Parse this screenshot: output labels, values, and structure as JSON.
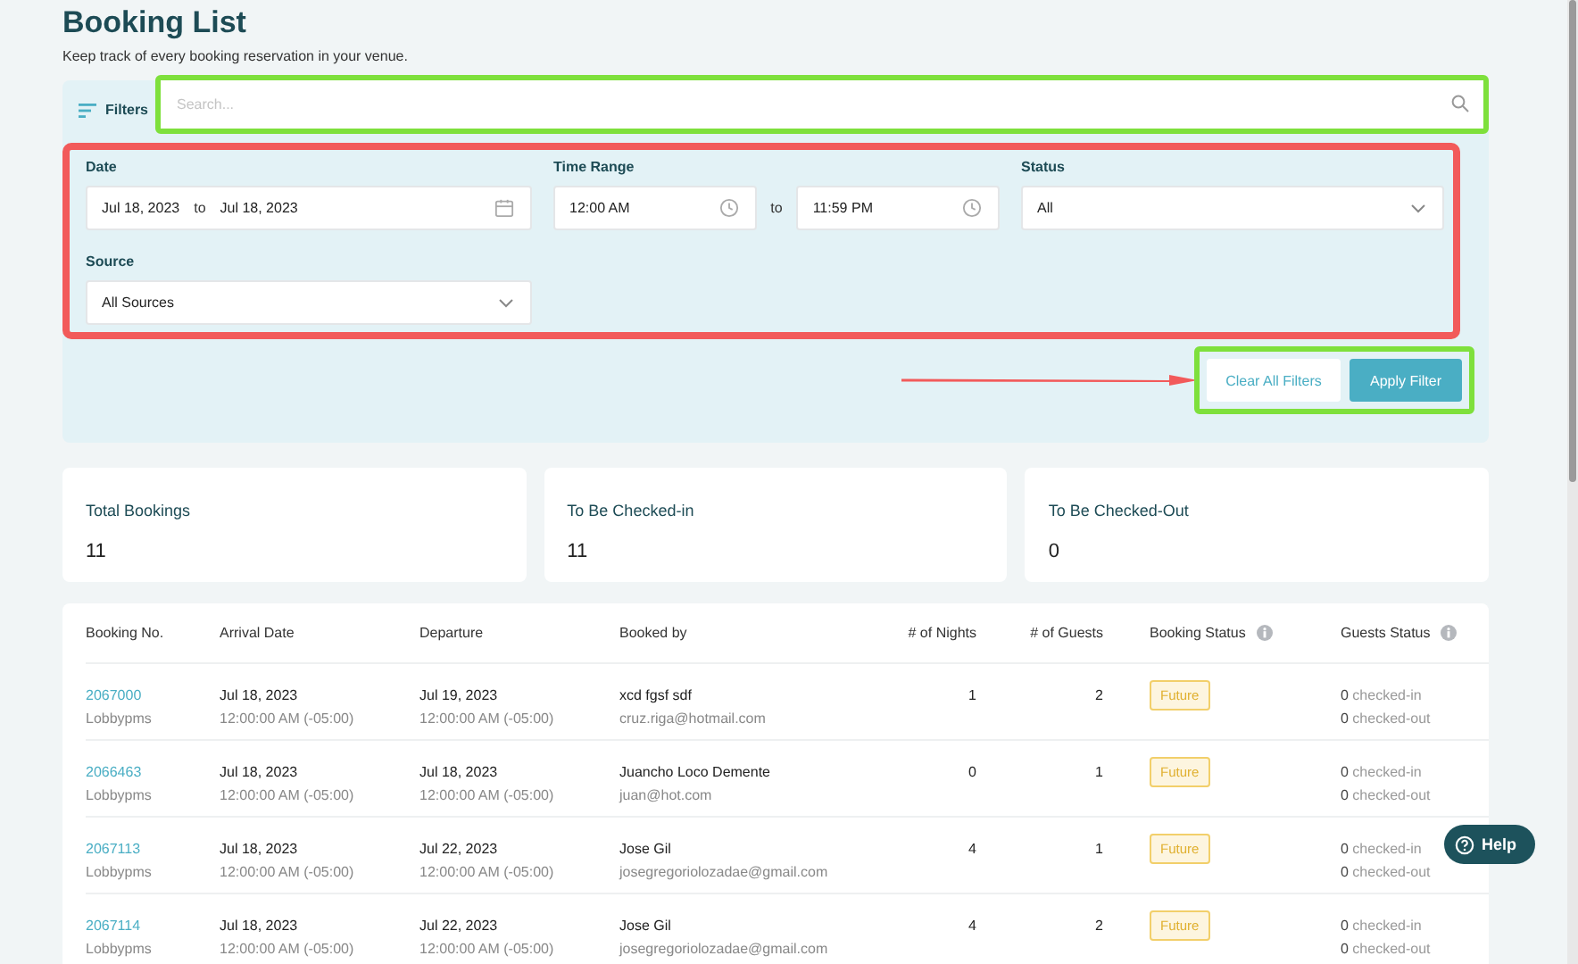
{
  "header": {
    "title": "Booking List",
    "subtitle": "Keep track of every booking reservation in your venue."
  },
  "filters": {
    "label": "Filters",
    "search": {
      "placeholder": "Search..."
    },
    "date": {
      "label": "Date",
      "from": "Jul 18, 2023",
      "separator": "to",
      "to": "Jul 18, 2023"
    },
    "time_range": {
      "label": "Time Range",
      "from": "12:00 AM",
      "separator": "to",
      "to": "11:59 PM"
    },
    "status": {
      "label": "Status",
      "value": "All"
    },
    "source": {
      "label": "Source",
      "value": "All Sources"
    },
    "buttons": [
      {
        "label": "Clear All Filters",
        "kind": "secondary"
      },
      {
        "label": "Apply Filter",
        "kind": "primary"
      }
    ]
  },
  "stats": [
    {
      "label": "Total Bookings",
      "value": "11"
    },
    {
      "label": "To Be Checked-in",
      "value": "11"
    },
    {
      "label": "To Be Checked-Out",
      "value": "0"
    }
  ],
  "table": {
    "columns": [
      {
        "label": "Booking No.",
        "info": false
      },
      {
        "label": "Arrival Date",
        "info": false
      },
      {
        "label": "Departure",
        "info": false
      },
      {
        "label": "Booked by",
        "info": false
      },
      {
        "label": "# of Nights",
        "info": false
      },
      {
        "label": "# of Guests",
        "info": false
      },
      {
        "label": "Booking Status",
        "info": true
      },
      {
        "label": "Guests Status",
        "info": true
      }
    ],
    "rows": [
      {
        "booking_no": "2067000",
        "source": "Lobbypms",
        "arrival_date": "Jul 18, 2023",
        "arrival_time": "12:00:00 AM (-05:00)",
        "departure_date": "Jul 19, 2023",
        "departure_time": "12:00:00 AM (-05:00)",
        "name": "xcd fgsf sdf",
        "email": "cruz.riga@hotmail.com",
        "nights": "1",
        "guests": "2",
        "status": "Future",
        "checked_in": "**0** checked-in",
        "checked_out": "**0** checked-out"
      },
      {
        "booking_no": "2066463",
        "source": "Lobbypms",
        "arrival_date": "Jul 18, 2023",
        "arrival_time": "12:00:00 AM (-05:00)",
        "departure_date": "Jul 18, 2023",
        "departure_time": "12:00:00 AM (-05:00)",
        "name": "Juancho Loco Demente",
        "email": "juan@hot.com",
        "nights": "0",
        "guests": "1",
        "status": "Future",
        "checked_in": "**0** checked-in",
        "checked_out": "**0** checked-out"
      },
      {
        "booking_no": "2067113",
        "source": "Lobbypms",
        "arrival_date": "Jul 18, 2023",
        "arrival_time": "12:00:00 AM (-05:00)",
        "departure_date": "Jul 22, 2023",
        "departure_time": "12:00:00 AM (-05:00)",
        "name": "Jose Gil",
        "email": "josegregoriolozadae@gmail.com",
        "nights": "4",
        "guests": "1",
        "status": "Future",
        "checked_in": "**0** checked-in",
        "checked_out": "**0** checked-out"
      },
      {
        "booking_no": "2067114",
        "source": "Lobbypms",
        "arrival_date": "Jul 18, 2023",
        "arrival_time": "12:00:00 AM (-05:00)",
        "departure_date": "Jul 22, 2023",
        "departure_time": "12:00:00 AM (-05:00)",
        "name": "Jose Gil",
        "email": "josegregoriolozadae@gmail.com",
        "nights": "4",
        "guests": "2",
        "status": "Future",
        "checked_in": "**0** checked-in",
        "checked_out": "**0** checked-out"
      }
    ]
  },
  "help_button": {
    "label": "Help"
  }
}
